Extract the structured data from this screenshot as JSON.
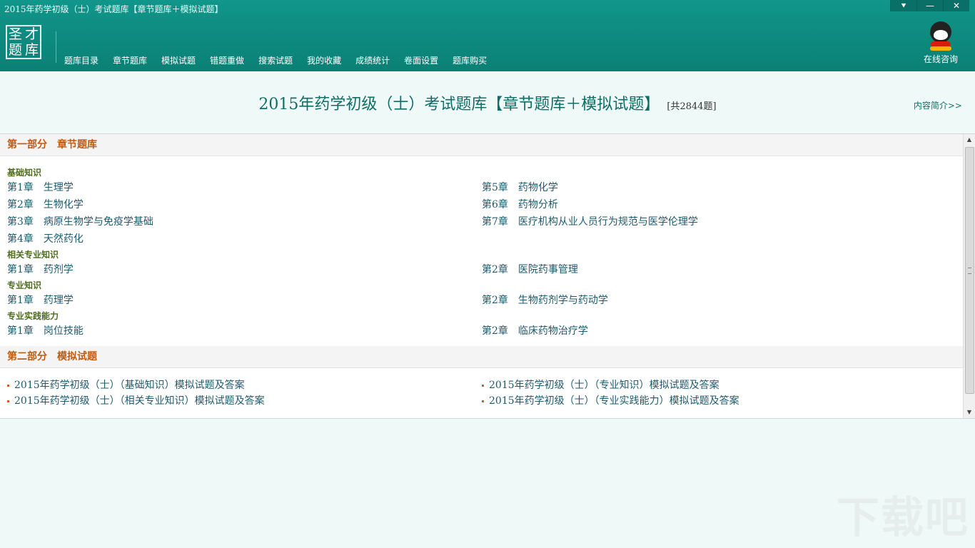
{
  "window": {
    "title": "2015年药学初级（士）考试题库【章节题库＋模拟试题】",
    "controls": [
      "⯆",
      "—",
      "✕"
    ]
  },
  "logo": {
    "chars": [
      "圣",
      "才",
      "题",
      "库"
    ]
  },
  "nav": {
    "items": [
      "题库目录",
      "章节题库",
      "模拟试题",
      "错题重做",
      "搜索试题",
      "我的收藏",
      "成绩统计",
      "卷面设置",
      "题库购买"
    ]
  },
  "consult": {
    "label": "在线咨询",
    "icon": "qq-penguin-icon"
  },
  "main": {
    "title": "2015年药学初级（士）考试题库【章节题库＋模拟试题】",
    "count": "[共2844题]",
    "intro_link": "内容简介>>"
  },
  "section1": {
    "title": "第一部分　章节题库",
    "categories": [
      {
        "name": "基础知识",
        "rows": [
          [
            {
              "num": "第1章",
              "name": "生理学"
            },
            {
              "num": "第5章",
              "name": "药物化学"
            }
          ],
          [
            {
              "num": "第2章",
              "name": "生物化学"
            },
            {
              "num": "第6章",
              "name": "药物分析"
            }
          ],
          [
            {
              "num": "第3章",
              "name": "病原生物学与免疫学基础"
            },
            {
              "num": "第7章",
              "name": "医疗机构从业人员行为规范与医学伦理学"
            }
          ],
          [
            {
              "num": "第4章",
              "name": "天然药化"
            },
            null
          ]
        ]
      },
      {
        "name": "相关专业知识",
        "rows": [
          [
            {
              "num": "第1章",
              "name": "药剂学"
            },
            {
              "num": "第2章",
              "name": "医院药事管理"
            }
          ]
        ]
      },
      {
        "name": "专业知识",
        "rows": [
          [
            {
              "num": "第1章",
              "name": "药理学"
            },
            {
              "num": "第2章",
              "name": "生物药剂学与药动学"
            }
          ]
        ]
      },
      {
        "name": "专业实践能力",
        "rows": [
          [
            {
              "num": "第1章",
              "name": "岗位技能"
            },
            {
              "num": "第2章",
              "name": "临床药物治疗学"
            }
          ]
        ]
      }
    ]
  },
  "section2": {
    "title": "第二部分　模拟试题",
    "rows": [
      [
        "2015年药学初级（士）（基础知识）模拟试题及答案",
        "2015年药学初级（士）（专业知识）模拟试题及答案"
      ],
      [
        "2015年药学初级（士）（相关专业知识）模拟试题及答案",
        "2015年药学初级（士）（专业实践能力）模拟试题及答案"
      ]
    ]
  },
  "watermark": "下载吧",
  "colors": {
    "header": "#0f8e84",
    "accent": "#c15a10",
    "link": "#1c5a6e"
  }
}
